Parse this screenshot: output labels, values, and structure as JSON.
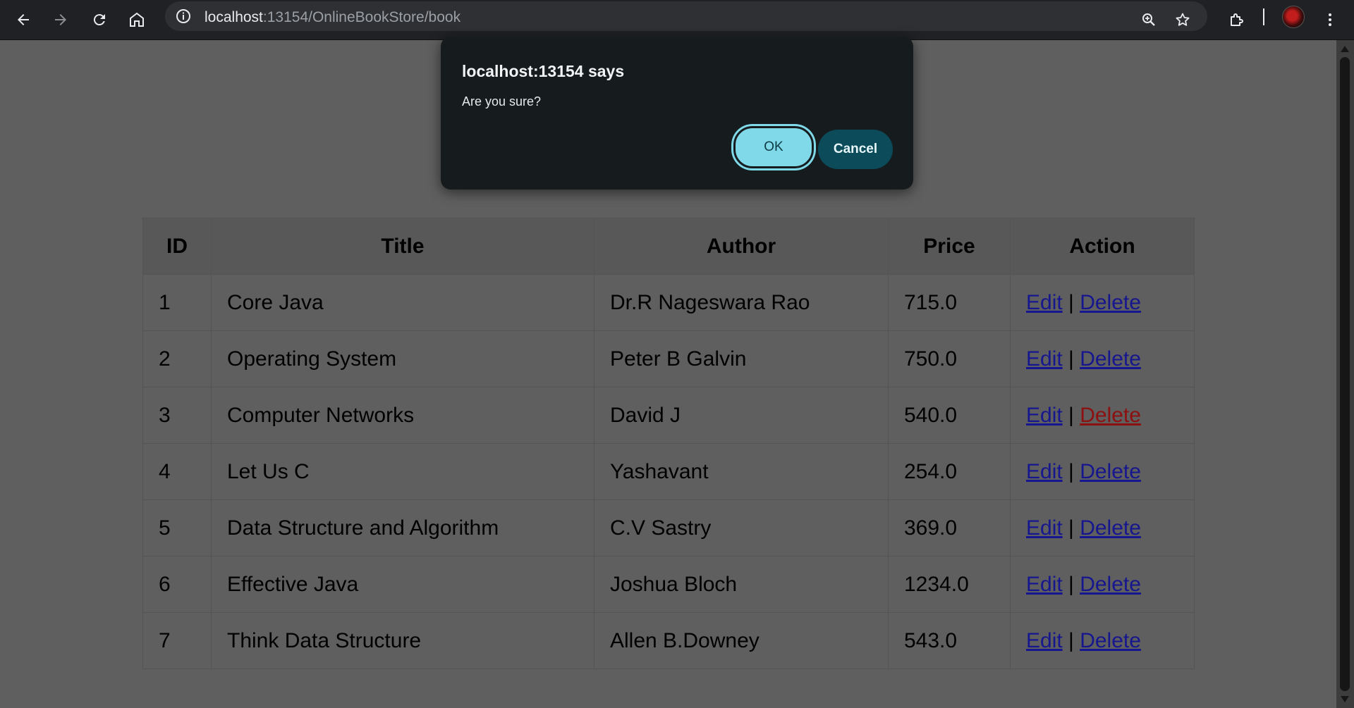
{
  "browser": {
    "url_host": "localhost",
    "url_rest": ":13154/OnlineBookStore/book"
  },
  "dialog": {
    "title": "localhost:13154 says",
    "message": "Are you sure?",
    "ok_label": "OK",
    "cancel_label": "Cancel"
  },
  "table": {
    "headers": [
      "ID",
      "Title",
      "Author",
      "Price",
      "Action"
    ],
    "rows": [
      {
        "id": "1",
        "title": "Core Java",
        "author": "Dr.R Nageswara Rao",
        "price": "715.0"
      },
      {
        "id": "2",
        "title": "Operating System",
        "author": "Peter B Galvin",
        "price": "750.0"
      },
      {
        "id": "3",
        "title": "Computer Networks",
        "author": "David J",
        "price": "540.0"
      },
      {
        "id": "4",
        "title": "Let Us C",
        "author": "Yashavant",
        "price": "254.0"
      },
      {
        "id": "5",
        "title": "Data Structure and Algorithm",
        "author": "C.V Sastry",
        "price": "369.0"
      },
      {
        "id": "6",
        "title": "Effective Java",
        "author": "Joshua Bloch",
        "price": "1234.0"
      },
      {
        "id": "7",
        "title": "Think Data Structure",
        "author": "Allen B.Downey",
        "price": "543.0"
      }
    ],
    "edit_label": "Edit",
    "delete_label": "Delete",
    "separator": "|"
  },
  "colors": {
    "link": "#16168e",
    "active_delete_link": "#8c1010",
    "dialog_bg": "#161b1e",
    "ok_button": "#7fd9e9",
    "cancel_button": "#0b4b5a"
  },
  "icons": [
    "back-arrow-icon",
    "forward-arrow-icon",
    "reload-icon",
    "home-icon",
    "site-info-icon",
    "zoom-icon",
    "bookmark-star-icon",
    "extensions-icon",
    "profile-avatar",
    "menu-dots-icon"
  ]
}
